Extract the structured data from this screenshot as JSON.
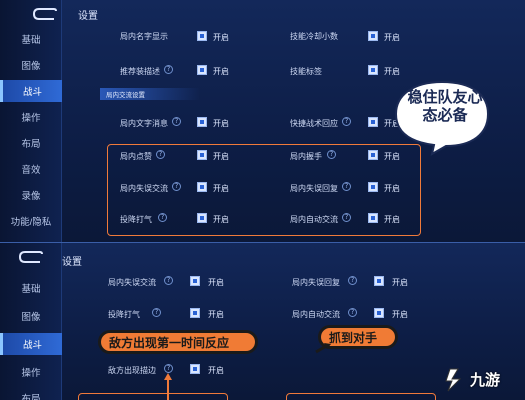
{
  "top_panel": {
    "title": "设置",
    "sidebar": [
      "基础",
      "图像",
      "战斗",
      "操作",
      "布局",
      "音效",
      "录像",
      "功能/隐私"
    ],
    "active_item": "战斗",
    "rows": [
      {
        "label": "局内名字显示",
        "help": false,
        "state": "开启"
      },
      {
        "label": "技能冷却小数",
        "help": false,
        "state": "开启"
      },
      {
        "label": "推荐装描述",
        "help": true,
        "state": "开启"
      },
      {
        "label": "技能标签",
        "help": false,
        "state": "开启"
      },
      {
        "label": "局内文字消息",
        "help": true,
        "state": "开启"
      },
      {
        "label": "快捷战术回应",
        "help": true,
        "state": "开启"
      },
      {
        "label": "局内点赞",
        "help": true,
        "state": "开启"
      },
      {
        "label": "局内握手",
        "help": true,
        "state": "开启"
      },
      {
        "label": "局内失误交流",
        "help": true,
        "state": "开启"
      },
      {
        "label": "局内失误回复",
        "help": true,
        "state": "开启"
      },
      {
        "label": "投降打气",
        "help": true,
        "state": "开启"
      },
      {
        "label": "局内自动交流",
        "help": true,
        "state": "开启"
      }
    ],
    "section_label": "局内交流设置",
    "bubble_text": "稳住队友心态必备"
  },
  "bottom_panel": {
    "title": "设置",
    "sidebar": [
      "基础",
      "图像",
      "战斗",
      "操作",
      "布局"
    ],
    "active_item": "战斗",
    "rows": [
      {
        "label": "局内失误交流",
        "help": true,
        "state": "开启"
      },
      {
        "label": "局内失误回复",
        "help": true,
        "state": "开启"
      },
      {
        "label": "投降打气",
        "help": true,
        "state": "开启"
      },
      {
        "label": "局内自动交流",
        "help": true,
        "state": "开启"
      },
      {
        "label": "敌方出现描边",
        "help": true,
        "state": "开启"
      }
    ],
    "callout_left": "敌方出现第一时间反应",
    "callout_right": "抓到对手"
  },
  "watermark": "九游",
  "colors": {
    "accent_orange": "#f07a3a",
    "active_blue": "#2f6ad6",
    "panel_bg": "#13285a"
  }
}
